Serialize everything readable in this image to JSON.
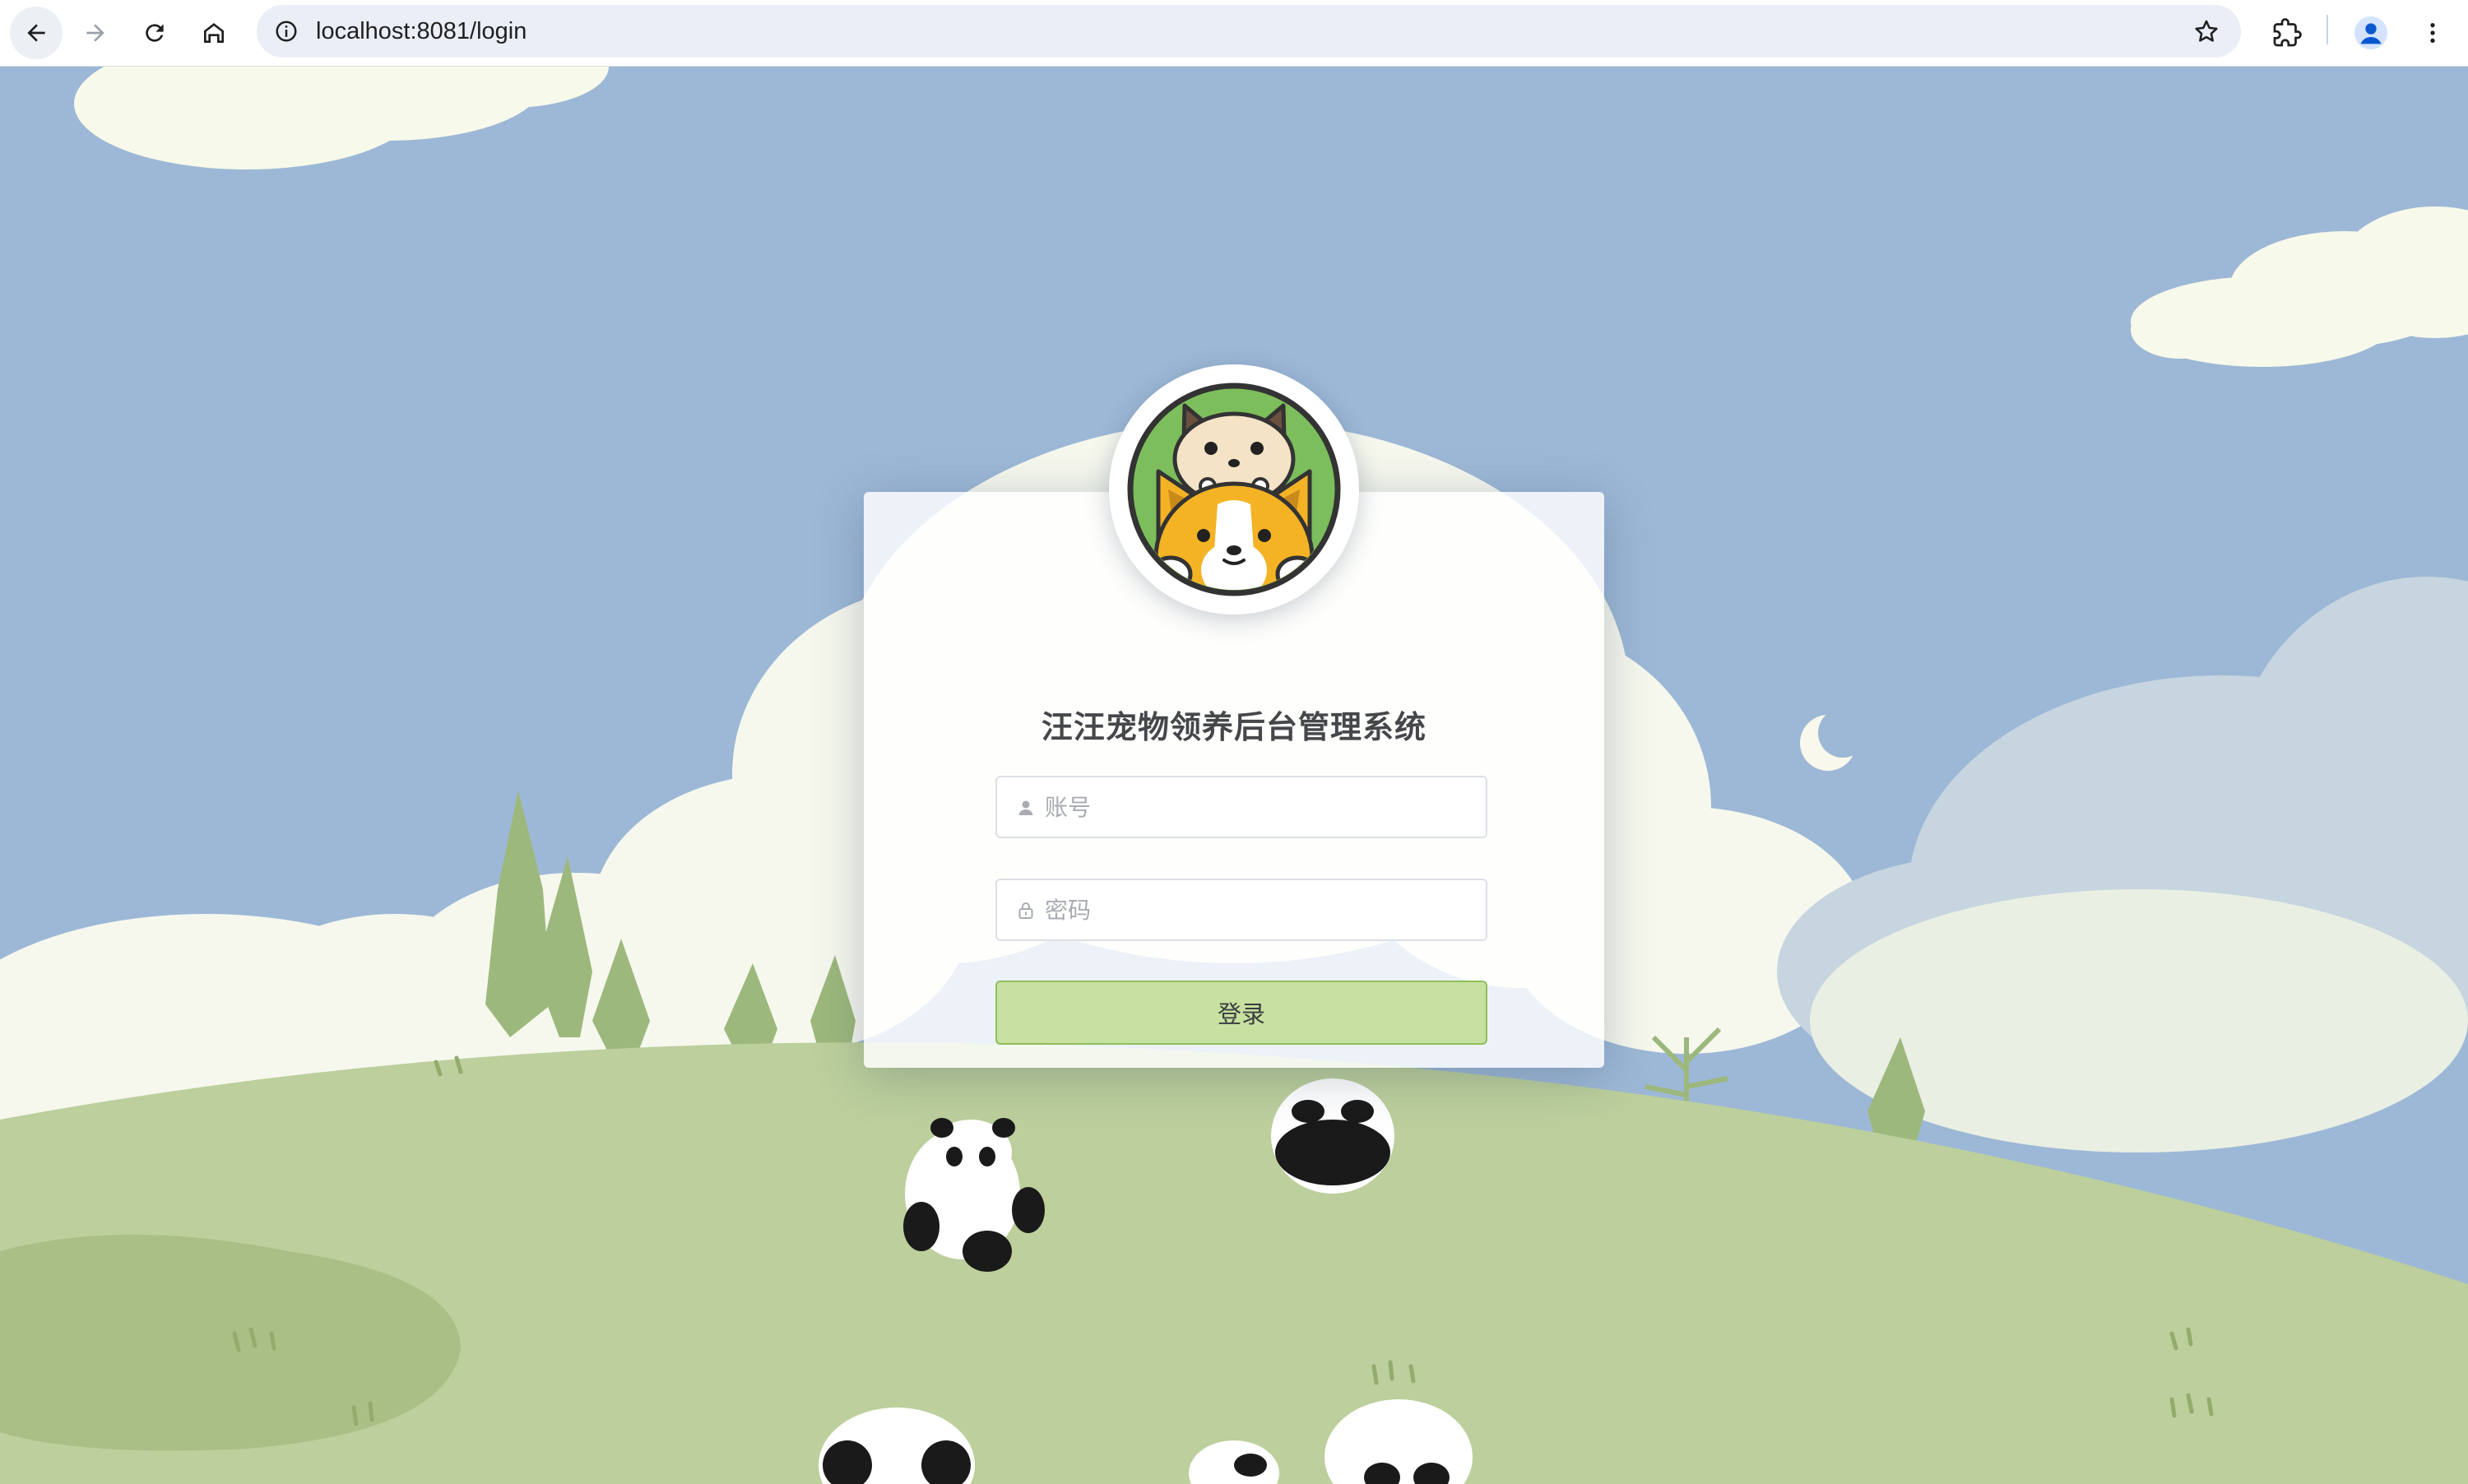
{
  "browser": {
    "url": "localhost:8081/login",
    "icons": {
      "back": "arrow-left-icon",
      "forward": "arrow-right-icon",
      "reload": "reload-icon",
      "home": "home-icon",
      "site_info": "info-icon",
      "bookmark": "star-icon",
      "extensions": "puzzle-icon",
      "profile": "person-icon",
      "menu": "kebab-menu-icon"
    }
  },
  "login": {
    "title": "汪汪宠物领养后台管理系统",
    "username_placeholder": "账号",
    "username_value": "",
    "password_placeholder": "密码",
    "password_value": "",
    "submit_label": "登录",
    "logo_icon": "cat-and-corgi-logo-icon"
  },
  "colors": {
    "sky": "#9db8d6",
    "grass": "#bccf9c",
    "button_bg": "#c8e0a0",
    "button_border": "#8fbf5a",
    "title_text": "#45474b"
  }
}
